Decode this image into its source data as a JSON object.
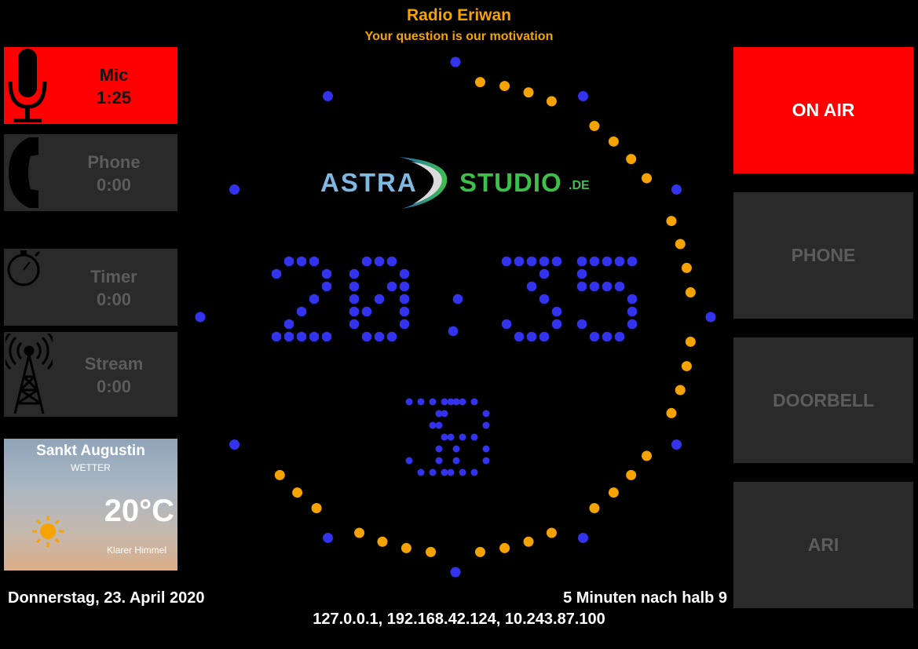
{
  "header": {
    "station_name": "Radio Eriwan",
    "slogan": "Your question is our motivation"
  },
  "left_panels": {
    "mic": {
      "label": "Mic",
      "time": "1:25",
      "icon": "microphone-icon"
    },
    "phone": {
      "label": "Phone",
      "time": "0:00",
      "icon": "phone-icon"
    },
    "timer": {
      "label": "Timer",
      "time": "0:00",
      "icon": "stopwatch-icon"
    },
    "stream": {
      "label": "Stream",
      "time": "0:00",
      "icon": "antenna-icon"
    }
  },
  "weather": {
    "city": "Sankt Augustin",
    "caption": "WETTER",
    "temperature": "20°C",
    "condition": "Klarer Himmel",
    "icon": "sun-icon"
  },
  "logo": {
    "part1": "ASTRA",
    "part2": "STUDIO",
    "suffix": ".DE"
  },
  "clock": {
    "hours": "20",
    "minutes": "35",
    "seconds": "38",
    "elapsed_second_dots": 38
  },
  "right_buttons": {
    "on_air": "ON AIR",
    "phone": "PHONE",
    "doorbell": "DOORBELL",
    "ari": "ARI"
  },
  "footer": {
    "date": "Donnerstag, 23. April 2020",
    "time_text": "5 Minuten nach halb 9",
    "ip_addresses": "127.0.0.1, 192.168.42.124, 10.243.87.100"
  },
  "colors": {
    "accent_orange": "#f5a300",
    "clock_blue": "#3333ee",
    "on_air_red": "#ff0000",
    "inactive_panel": "#2a2a2a",
    "inactive_text": "#5c5c5c"
  }
}
